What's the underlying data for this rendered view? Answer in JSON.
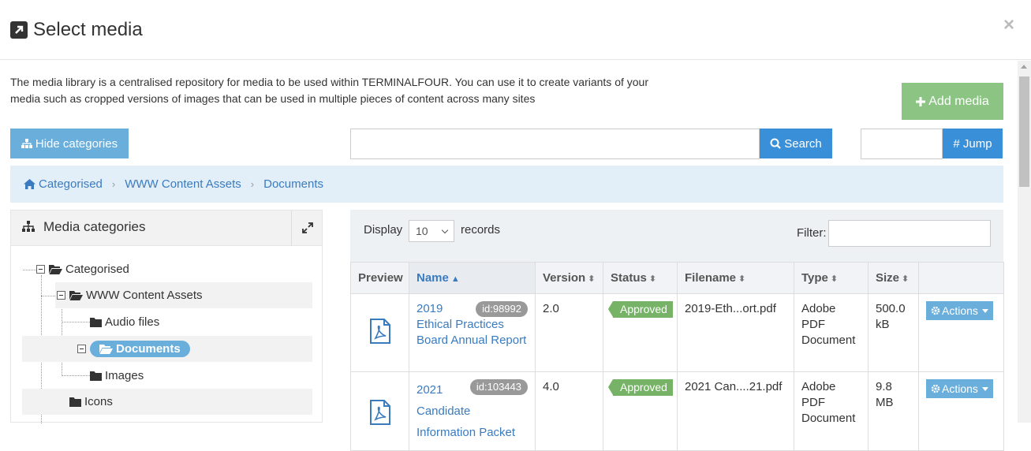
{
  "dialog": {
    "title": "Select media",
    "close_label": "×"
  },
  "intro": "The media library is a centralised repository for media to be used within TERMINALFOUR. You can use it to create variants of your media such as cropped versions of images that can be used in multiple pieces of content across many sites",
  "toolbar": {
    "add_media_label": "Add media",
    "hide_categories_label": "Hide categories",
    "search_label": "Search",
    "search_value": "",
    "jump_label": "# Jump",
    "jump_value": ""
  },
  "breadcrumb": [
    "Categorised",
    "WWW Content Assets",
    "Documents"
  ],
  "categories": {
    "title": "Media categories",
    "tree": [
      {
        "label": "Categorised",
        "level": 0,
        "state": "open"
      },
      {
        "label": "WWW Content Assets",
        "level": 1,
        "state": "open"
      },
      {
        "label": "Audio files",
        "level": 2,
        "state": "leaf"
      },
      {
        "label": "Documents",
        "level": 2,
        "state": "selected"
      },
      {
        "label": "Images",
        "level": 2,
        "state": "leaf"
      },
      {
        "label": "Icons",
        "level": 1,
        "state": "leaf"
      }
    ]
  },
  "list": {
    "display_label": "Display",
    "display_value": "10",
    "records_label": "records",
    "filter_label": "Filter:",
    "filter_value": "",
    "columns": [
      "Preview",
      "Name",
      "Version",
      "Status",
      "Filename",
      "Type",
      "Size",
      ""
    ],
    "sorted_column": "Name",
    "rows": [
      {
        "name": "2019 Ethical Practices Board Annual Report",
        "id": "id:98992",
        "version": "2.0",
        "status": "Approved",
        "filename": "2019-Eth...ort.pdf",
        "type": "Adobe PDF Document",
        "size": "500.0 kB",
        "action": "Actions"
      },
      {
        "name": "2021 Candidate Information Packet",
        "id": "id:103443",
        "version": "4.0",
        "status": "Approved",
        "filename": "2021 Can....21.pdf",
        "type": "Adobe PDF Document",
        "size": "9.8 MB",
        "action": "Actions"
      }
    ]
  },
  "colors": {
    "accent": "#3a8fd9",
    "add_button": "#8cc484",
    "approved": "#76b366",
    "light_button": "#6aaedc"
  }
}
